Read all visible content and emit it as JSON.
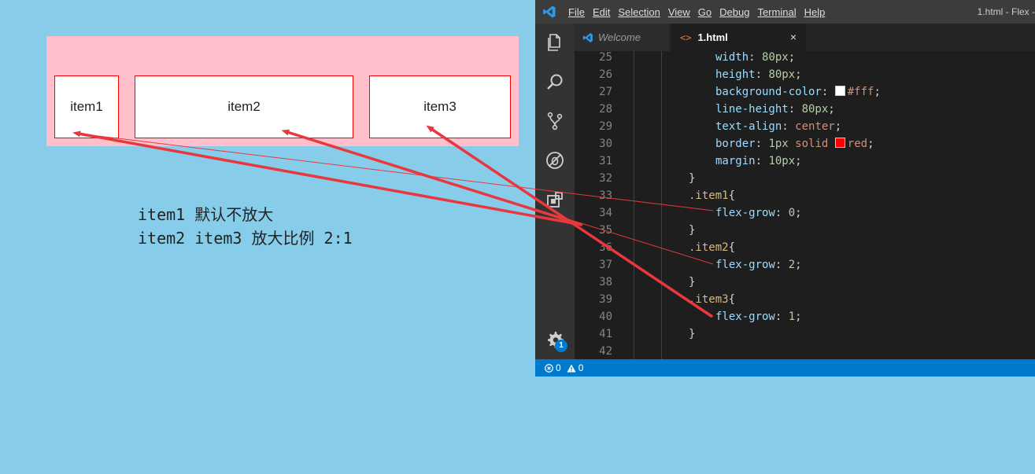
{
  "demo": {
    "items": [
      "item1",
      "item2",
      "item3"
    ]
  },
  "note": {
    "line1": "item1 默认不放大",
    "line2": "item2 item3 放大比例 2:1"
  },
  "window": {
    "title": "1.html - Flex -",
    "menu": [
      "File",
      "Edit",
      "Selection",
      "View",
      "Go",
      "Debug",
      "Terminal",
      "Help"
    ]
  },
  "tabs": {
    "welcome": "Welcome",
    "active": "1.html",
    "close": "×"
  },
  "editor": {
    "lines": [
      {
        "n": "25",
        "parts": [
          [
            "prop",
            "width"
          ],
          [
            "punc",
            ": "
          ],
          [
            "num",
            "80px"
          ],
          [
            "punc",
            ";"
          ]
        ],
        "indent": 3
      },
      {
        "n": "26",
        "parts": [
          [
            "prop",
            "height"
          ],
          [
            "punc",
            ": "
          ],
          [
            "num",
            "80px"
          ],
          [
            "punc",
            ";"
          ]
        ],
        "indent": 3
      },
      {
        "n": "27",
        "parts": [
          [
            "prop",
            "background-color"
          ],
          [
            "punc",
            ": "
          ],
          [
            "swatch",
            "#fff"
          ],
          [
            "val",
            "#fff"
          ],
          [
            "punc",
            ";"
          ]
        ],
        "indent": 3
      },
      {
        "n": "28",
        "parts": [
          [
            "prop",
            "line-height"
          ],
          [
            "punc",
            ": "
          ],
          [
            "num",
            "80px"
          ],
          [
            "punc",
            ";"
          ]
        ],
        "indent": 3
      },
      {
        "n": "29",
        "parts": [
          [
            "prop",
            "text-align"
          ],
          [
            "punc",
            ": "
          ],
          [
            "val",
            "center"
          ],
          [
            "punc",
            ";"
          ]
        ],
        "indent": 3
      },
      {
        "n": "30",
        "parts": [
          [
            "prop",
            "border"
          ],
          [
            "punc",
            ": "
          ],
          [
            "num",
            "1px"
          ],
          [
            "punc",
            " "
          ],
          [
            "val",
            "solid"
          ],
          [
            "punc",
            " "
          ],
          [
            "swatch",
            "red"
          ],
          [
            "val",
            "red"
          ],
          [
            "punc",
            ";"
          ]
        ],
        "indent": 3
      },
      {
        "n": "31",
        "parts": [
          [
            "prop",
            "margin"
          ],
          [
            "punc",
            ": "
          ],
          [
            "num",
            "10px"
          ],
          [
            "punc",
            ";"
          ]
        ],
        "indent": 3
      },
      {
        "n": "32",
        "parts": [
          [
            "punc",
            "}"
          ]
        ],
        "indent": 2
      },
      {
        "n": "33",
        "parts": [
          [
            "sel",
            ".item1"
          ],
          [
            "punc",
            "{"
          ]
        ],
        "indent": 2
      },
      {
        "n": "34",
        "parts": [
          [
            "prop",
            "flex-grow"
          ],
          [
            "punc",
            ": "
          ],
          [
            "num",
            "0"
          ],
          [
            "punc",
            ";"
          ]
        ],
        "indent": 3
      },
      {
        "n": "35",
        "parts": [
          [
            "punc",
            "}"
          ]
        ],
        "indent": 2
      },
      {
        "n": "36",
        "parts": [
          [
            "sel",
            ".item2"
          ],
          [
            "punc",
            "{"
          ]
        ],
        "indent": 2
      },
      {
        "n": "37",
        "parts": [
          [
            "prop",
            "flex-grow"
          ],
          [
            "punc",
            ": "
          ],
          [
            "num",
            "2"
          ],
          [
            "punc",
            ";"
          ]
        ],
        "indent": 3
      },
      {
        "n": "38",
        "parts": [
          [
            "punc",
            "}"
          ]
        ],
        "indent": 2
      },
      {
        "n": "39",
        "parts": [
          [
            "sel",
            ".item3"
          ],
          [
            "punc",
            "{"
          ]
        ],
        "indent": 2
      },
      {
        "n": "40",
        "parts": [
          [
            "prop",
            "flex-grow"
          ],
          [
            "punc",
            ": "
          ],
          [
            "num",
            "1"
          ],
          [
            "punc",
            ";"
          ]
        ],
        "indent": 3
      },
      {
        "n": "41",
        "parts": [
          [
            "punc",
            "}"
          ]
        ],
        "indent": 2
      },
      {
        "n": "42",
        "parts": [],
        "indent": 0
      }
    ]
  },
  "activity_icons": [
    "explorer-icon",
    "search-icon",
    "source-control-icon",
    "debug-icon",
    "extensions-icon",
    "settings-gear-icon"
  ],
  "badge": "1",
  "status": {
    "errors": "0",
    "warnings": "0"
  },
  "colors": {
    "accent": "#007ACC",
    "arrow": "#E8383D",
    "demo_bg": "#FFC0CB",
    "page_bg": "#87CDEA"
  }
}
